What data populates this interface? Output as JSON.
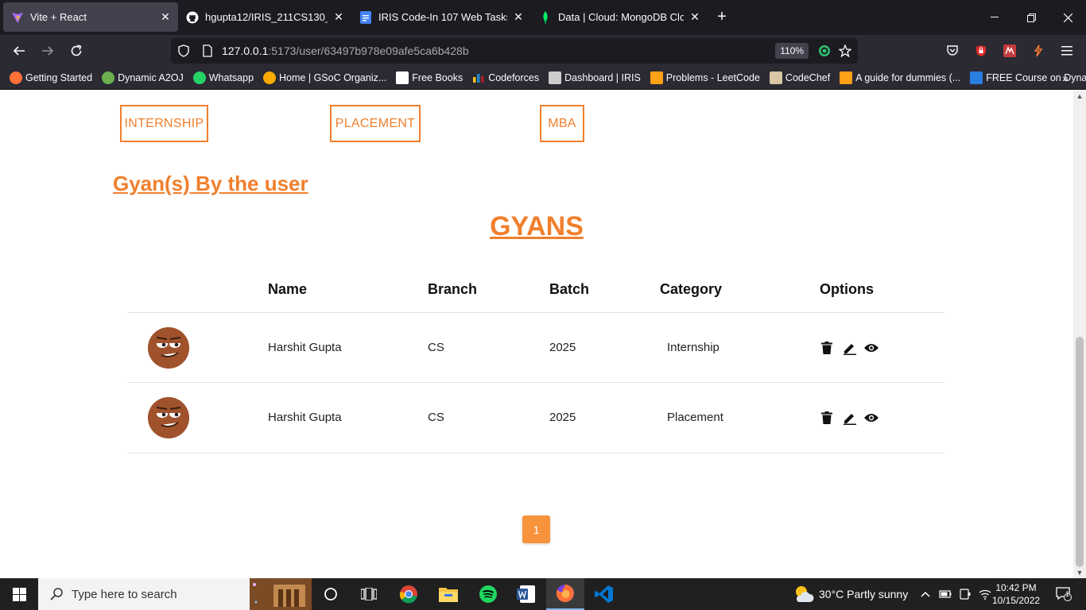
{
  "browser": {
    "tabs": [
      {
        "label": "Vite + React",
        "active": true
      },
      {
        "label": "hgupta12/IRIS_211CS130_2_MERN",
        "active": false
      },
      {
        "label": "IRIS Code-In 107 Web Tasks - Goo",
        "active": false
      },
      {
        "label": "Data | Cloud: MongoDB Cloud",
        "active": false
      }
    ],
    "new_tab": "+",
    "url_host": "127.0.0.1",
    "url_path": ":5173/user/63497b978e09afe5ca6b428b",
    "zoom": "110%",
    "bookmarks": [
      {
        "label": "Getting Started",
        "icon": "firefox-icon",
        "color": "#ff7139"
      },
      {
        "label": "Dynamic A2OJ",
        "icon": "frog-icon",
        "color": "#6ab04c"
      },
      {
        "label": "Whatsapp",
        "icon": "whatsapp-icon",
        "color": "#25d366"
      },
      {
        "label": "Home | GSoC Organiz...",
        "icon": "gsoc-icon",
        "color": "#f9ab00"
      },
      {
        "label": "Free Books",
        "icon": "book-icon",
        "color": "#ffffff"
      },
      {
        "label": "Codeforces",
        "icon": "codeforces-icon",
        "color": "#1f8acb"
      },
      {
        "label": "Dashboard | IRIS",
        "icon": "iris-icon",
        "color": "#cccccc"
      },
      {
        "label": "Problems - LeetCode",
        "icon": "leetcode-icon",
        "color": "#ffa116"
      },
      {
        "label": "CodeChef",
        "icon": "codechef-icon",
        "color": "#d9c6a5"
      },
      {
        "label": "A guide for dummies (...",
        "icon": "guide-icon",
        "color": "#ffa116"
      },
      {
        "label": "FREE Course on Dyna...",
        "icon": "course-icon",
        "color": "#2a7de1"
      }
    ]
  },
  "page": {
    "categories": [
      "INTERNSHIP",
      "PLACEMENT",
      "MBA"
    ],
    "section_title": "Gyan(s) By the user",
    "gyans_title": "GYANS",
    "table": {
      "headers": [
        "Name",
        "Branch",
        "Batch",
        "Category",
        "Options"
      ],
      "rows": [
        {
          "name": "Harshit Gupta",
          "branch": "CS",
          "batch": "2025",
          "category": "Internship"
        },
        {
          "name": "Harshit Gupta",
          "branch": "CS",
          "batch": "2025",
          "category": "Placement"
        }
      ]
    },
    "pagination": {
      "current": "1"
    },
    "accent": "#f07f2c"
  },
  "taskbar": {
    "search_placeholder": "Type here to search",
    "weather": "30°C  Partly sunny",
    "time": "10:42 PM",
    "date": "10/15/2022",
    "notification_count": "1"
  }
}
